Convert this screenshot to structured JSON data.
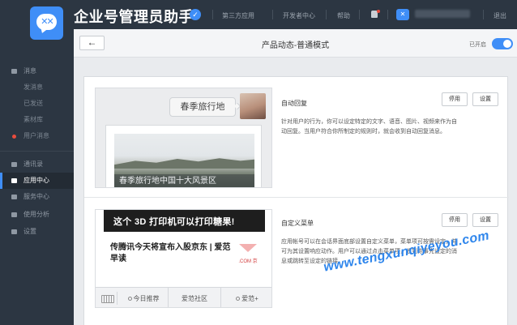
{
  "header": {
    "app_title": "企业号管理员助手",
    "nav": [
      "第三方应用",
      "开发者中心",
      "帮助"
    ],
    "logout": "退出"
  },
  "sidebar": {
    "items": [
      {
        "label": "消息",
        "icon": "message-icon"
      },
      {
        "label": "发消息"
      },
      {
        "label": "已发送"
      },
      {
        "label": "素材库"
      },
      {
        "label": "用户消息"
      },
      {
        "label": "通讯录",
        "icon": "contacts-icon"
      },
      {
        "label": "应用中心",
        "icon": "app-center-icon"
      },
      {
        "label": "服务中心",
        "icon": "service-icon"
      },
      {
        "label": "使用分析",
        "icon": "analytics-icon"
      },
      {
        "label": "设置",
        "icon": "settings-icon"
      }
    ]
  },
  "main": {
    "back_label": "←",
    "page_title": "产品动态-普通模式",
    "enabled_label": "已开启",
    "enabled": true
  },
  "features": [
    {
      "name": "自动回复",
      "description": "针对用户的行为，你可以设定特定的文字、语音、图片、视频来作为自动回复。当用户符合你所制定的规则时，就会收到自动回复消息。",
      "disable_label": "停用",
      "settings_label": "设置",
      "preview": {
        "keyword": "春季旅行地",
        "news_caption": "春季旅行地中国十大风景区"
      }
    },
    {
      "name": "自定义菜单",
      "description": "应用帐号可以在会话界面底部设置自定义菜单，菜单项可按需设定，并可为其设置响应动作。用户可以通过点击菜单项，收到你事先设定的消息或跳转至设定的链接。",
      "disable_label": "停用",
      "settings_label": "设置",
      "preview": {
        "banner": "这个 3D 打印机可以打印糖果!",
        "article_title": "传腾讯今天将宣布入股京东 | 爱范早读",
        "thumb_text": ".COM 京",
        "menu": [
          "今日推荐",
          "爱范社区",
          "爱范+"
        ]
      }
    }
  ],
  "watermark": "www.tengxunqiyeyou.com",
  "colors": {
    "topbar": "#2c3642",
    "accent": "#3f8ef7",
    "alert": "#e84c3d"
  }
}
